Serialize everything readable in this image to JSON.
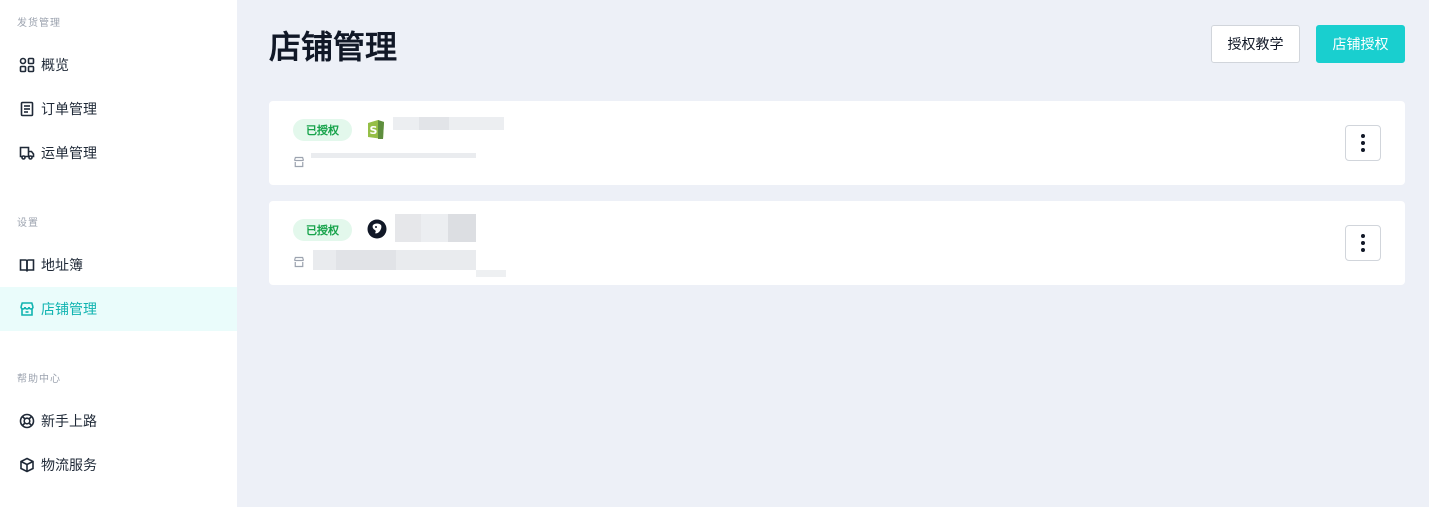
{
  "sidebar": {
    "sections": [
      {
        "title": "发货管理",
        "items": [
          {
            "label": "概览",
            "icon": "grid-icon"
          },
          {
            "label": "订单管理",
            "icon": "document-icon"
          },
          {
            "label": "运单管理",
            "icon": "truck-icon"
          }
        ]
      },
      {
        "title": "设置",
        "items": [
          {
            "label": "地址簿",
            "icon": "book-icon"
          },
          {
            "label": "店铺管理",
            "icon": "store-icon",
            "active": true
          }
        ]
      },
      {
        "title": "帮助中心",
        "items": [
          {
            "label": "新手上路",
            "icon": "lifebuoy-icon"
          },
          {
            "label": "物流服务",
            "icon": "package-icon"
          }
        ]
      }
    ]
  },
  "header": {
    "title": "店铺管理",
    "tutorial_button": "授权教学",
    "authorize_button": "店铺授权"
  },
  "stores": [
    {
      "status": "已授权",
      "platform_icon": "shopify-icon"
    },
    {
      "status": "已授权",
      "platform_icon": "penguin-icon"
    }
  ],
  "colors": {
    "accent": "#19cfcf",
    "active_bg": "#eafcfb",
    "badge_bg": "#e3f8ec",
    "badge_text": "#16a34a"
  }
}
